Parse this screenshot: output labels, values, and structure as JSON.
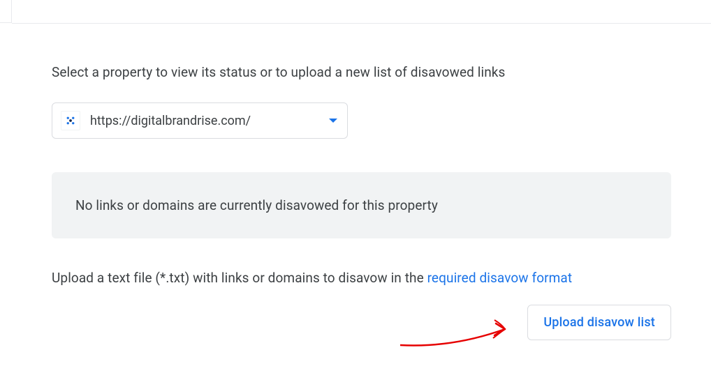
{
  "main": {
    "instruction": "Select a property to view its status or to upload a new list of disavowed links",
    "selected_property": "https://digitalbrandrise.com/",
    "status_message": "No links or domains are currently disavowed for this property",
    "upload_description_before": "Upload a text file (*.txt) with links or domains to disavow in the ",
    "upload_description_link": "required disavow format",
    "upload_button_label": "Upload disavow list"
  },
  "colors": {
    "primary": "#1a73e8",
    "text": "#3c4043",
    "border": "#dadce0",
    "panel": "#f1f3f4"
  }
}
